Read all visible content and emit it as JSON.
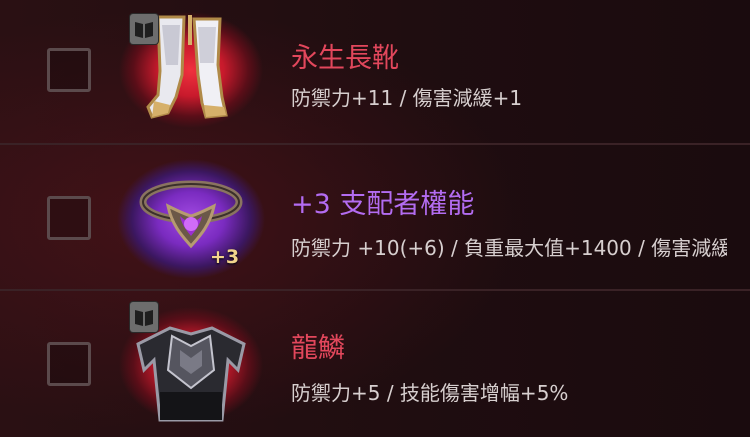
{
  "items": [
    {
      "name": "永生長靴",
      "stats": "防禦力+11 / 傷害減緩+1",
      "rarity": "legendary",
      "name_color": "#e2475c",
      "icon": "boots-icon",
      "badge_icon": "book-icon",
      "upgrade": ""
    },
    {
      "name": "+3 支配者權能",
      "stats": "防禦力 +10(+6) / 負重最大值+1400 / 傷害減緩",
      "rarity": "epic",
      "name_color": "#b36cf1",
      "icon": "amulet-icon",
      "badge_icon": "",
      "upgrade": "+3"
    },
    {
      "name": "龍鱗",
      "stats": "防禦力+5 / 技能傷害增幅+5%",
      "rarity": "legendary",
      "name_color": "#e2475c",
      "icon": "scale-armor-icon",
      "badge_icon": "book-icon",
      "upgrade": ""
    }
  ]
}
